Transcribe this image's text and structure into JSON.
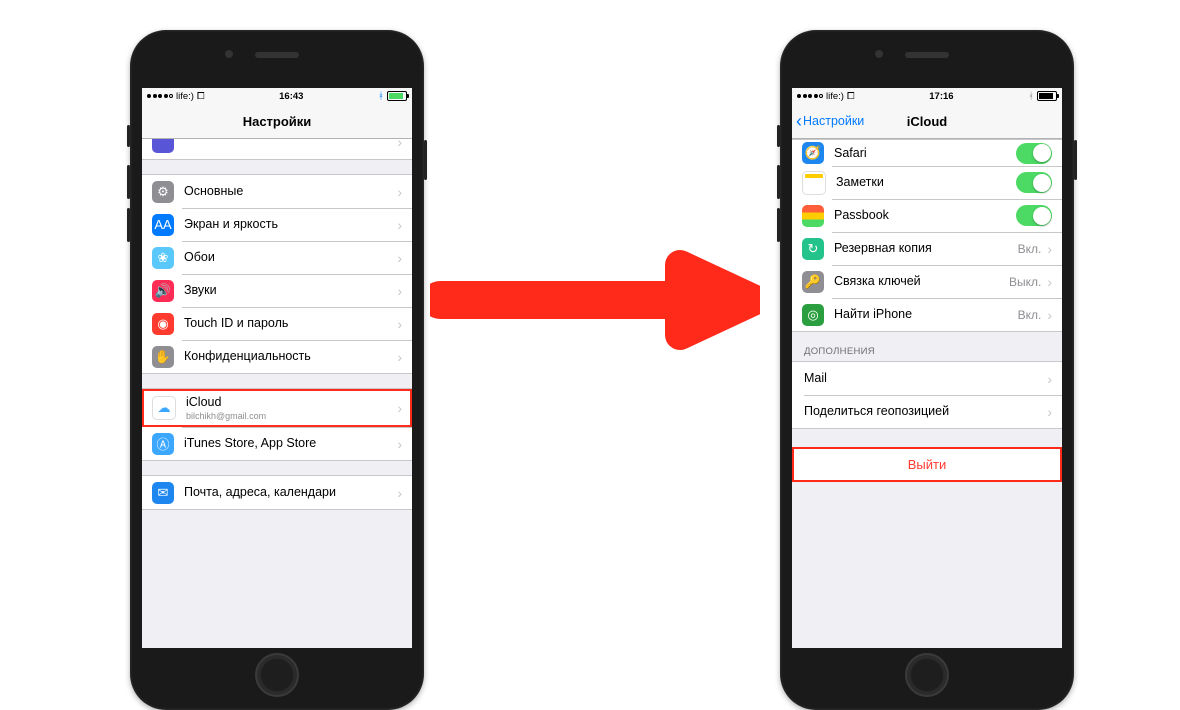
{
  "phone1": {
    "status": {
      "carrier": "life:)",
      "time": "16:43"
    },
    "title": "Настройки",
    "rows": {
      "general": "Основные",
      "display": "Экран и яркость",
      "wallpaper": "Обои",
      "sounds": "Звуки",
      "touchid": "Touch ID и пароль",
      "privacy": "Конфиденциальность",
      "icloud": "iCloud",
      "icloud_sub": "bilchikh@gmail.com",
      "itunes": "iTunes Store, App Store",
      "mail": "Почта, адреса, календари"
    }
  },
  "phone2": {
    "status": {
      "carrier": "life:)",
      "time": "17:16"
    },
    "back": "Настройки",
    "title": "iCloud",
    "rows": {
      "safari": "Safari",
      "notes": "Заметки",
      "passbook": "Passbook",
      "backup": "Резервная копия",
      "backup_v": "Вкл.",
      "keychain": "Связка ключей",
      "keychain_v": "Выкл.",
      "findiphone": "Найти iPhone",
      "findiphone_v": "Вкл."
    },
    "section": "ДОПОЛНЕНИЯ",
    "extras": {
      "mail": "Mail",
      "share": "Поделиться геопозицией"
    },
    "signout": "Выйти"
  }
}
